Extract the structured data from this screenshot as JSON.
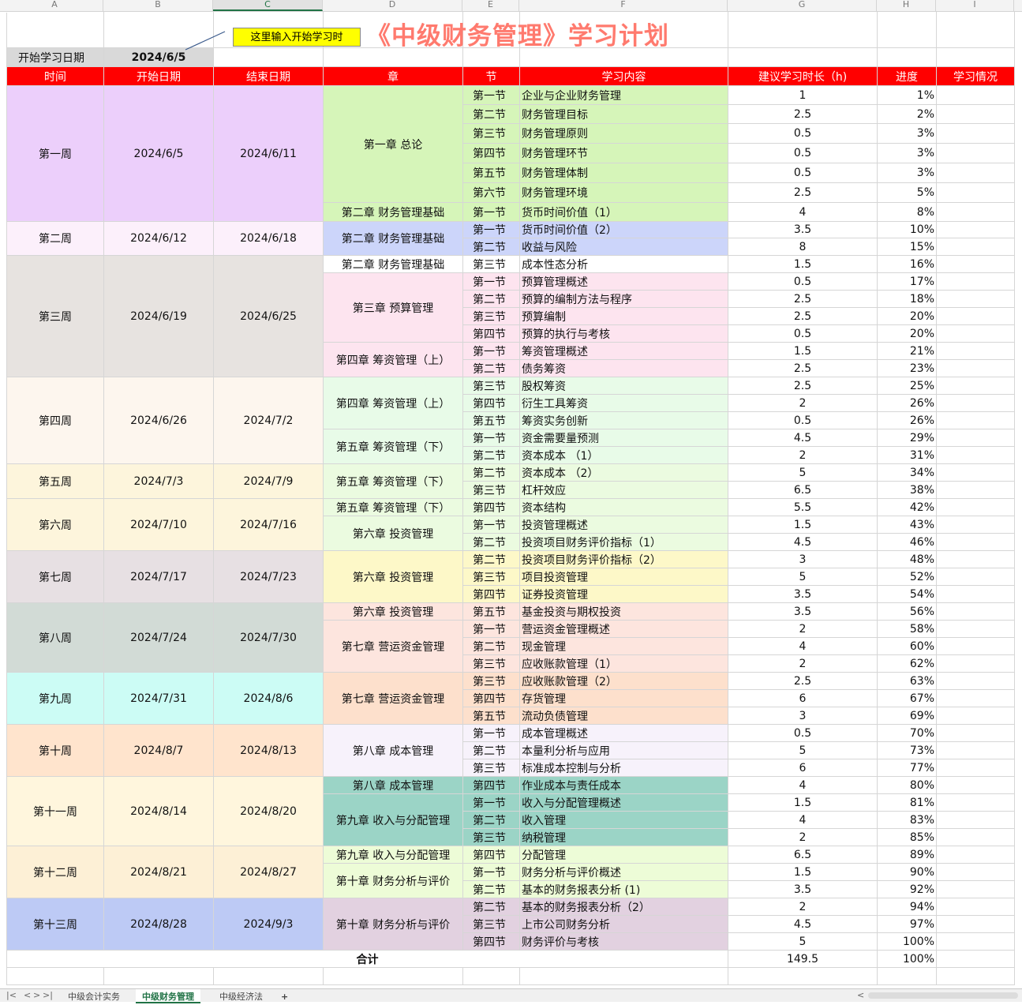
{
  "columns": [
    "A",
    "B",
    "C",
    "D",
    "E",
    "F",
    "G",
    "H",
    "I"
  ],
  "title": "《中级财务管理》学习计划",
  "note": "这里输入开始学习时",
  "start": {
    "label": "开始学习日期",
    "value": "2024/6/5"
  },
  "headers": [
    "时间",
    "开始日期",
    "结束日期",
    "章",
    "节",
    "学习内容",
    "建议学习时长（h)",
    "进度",
    "学习情况"
  ],
  "weeks": [
    {
      "name": "第一周",
      "start": "2024/6/5",
      "end": "2024/6/11",
      "rows": 7,
      "color": "#eccffb"
    },
    {
      "name": "第二周",
      "start": "2024/6/12",
      "end": "2024/6/18",
      "rows": 2,
      "color": "#fcf0fb"
    },
    {
      "name": "第三周",
      "start": "2024/6/19",
      "end": "2024/6/25",
      "rows": 7,
      "color": "#e7e3e0"
    },
    {
      "name": "第四周",
      "start": "2024/6/26",
      "end": "2024/7/2",
      "rows": 5,
      "color": "#fdf6ee"
    },
    {
      "name": "第五周",
      "start": "2024/7/3",
      "end": "2024/7/9",
      "rows": 2,
      "color": "#fdf5dc"
    },
    {
      "name": "第六周",
      "start": "2024/7/10",
      "end": "2024/7/16",
      "rows": 3,
      "color": "#fdf5dc"
    },
    {
      "name": "第七周",
      "start": "2024/7/17",
      "end": "2024/7/23",
      "rows": 3,
      "color": "#e7e0e3"
    },
    {
      "name": "第八周",
      "start": "2024/7/24",
      "end": "2024/7/30",
      "rows": 4,
      "color": "#d2dbd6"
    },
    {
      "name": "第九周",
      "start": "2024/7/31",
      "end": "2024/8/6",
      "rows": 3,
      "color": "#ccfcf5"
    },
    {
      "name": "第十周",
      "start": "2024/8/7",
      "end": "2024/8/13",
      "rows": 3,
      "color": "#ffe4cd"
    },
    {
      "name": "第十一周",
      "start": "2024/8/14",
      "end": "2024/8/20",
      "rows": 4,
      "color": "#fff6dd"
    },
    {
      "name": "第十二周",
      "start": "2024/8/21",
      "end": "2024/8/27",
      "rows": 3,
      "color": "#fdf0d6"
    },
    {
      "name": "第十三周",
      "start": "2024/8/28",
      "end": "2024/9/3",
      "rows": 3,
      "color": "#bdcaf5"
    }
  ],
  "chapters": [
    {
      "name": "第一章 总论",
      "rows": 6,
      "color": "#d6f5b9"
    },
    {
      "name": "第二章 财务管理基础",
      "rows": 1,
      "color": "#d6f5b9"
    },
    {
      "name": "第二章 财务管理基础",
      "rows": 2,
      "color": "#ccd5fa"
    },
    {
      "name": "第二章 财务管理基础",
      "rows": 1,
      "color": "#ffffff"
    },
    {
      "name": "第三章 预算管理",
      "rows": 4,
      "color": "#fde4ef"
    },
    {
      "name": "第四章 筹资管理（上）",
      "rows": 2,
      "color": "#fde4ef"
    },
    {
      "name": "第四章 筹资管理（上）",
      "rows": 3,
      "color": "#e8fbe8"
    },
    {
      "name": "第五章 筹资管理（下）",
      "rows": 2,
      "color": "#e8fbe8"
    },
    {
      "name": "第五章 筹资管理（下）",
      "rows": 2,
      "color": "#ebfbe0"
    },
    {
      "name": "第五章 筹资管理（下）",
      "rows": 1,
      "color": "#ebfbe0"
    },
    {
      "name": "第六章 投资管理",
      "rows": 2,
      "color": "#ebfbe0"
    },
    {
      "name": "第六章 投资管理",
      "rows": 3,
      "color": "#fdf8c8"
    },
    {
      "name": "第六章 投资管理",
      "rows": 1,
      "color": "#fde5de"
    },
    {
      "name": "第七章 营运资金管理",
      "rows": 3,
      "color": "#fde5de"
    },
    {
      "name": "第七章 营运资金管理",
      "rows": 3,
      "color": "#fde0cc"
    },
    {
      "name": "第八章 成本管理",
      "rows": 3,
      "color": "#f7f2fb"
    },
    {
      "name": "第八章 成本管理",
      "rows": 1,
      "color": "#9bd4c6"
    },
    {
      "name": "第九章 收入与分配管理",
      "rows": 3,
      "color": "#9bd4c6"
    },
    {
      "name": "第九章 收入与分配管理",
      "rows": 1,
      "color": "#edfcd7"
    },
    {
      "name": "第十章 财务分析与评价",
      "rows": 2,
      "color": "#edfcd7"
    },
    {
      "name": "第十章 财务分析与评价",
      "rows": 3,
      "color": "#e2d1e0"
    }
  ],
  "rows": [
    {
      "sec": "第一节",
      "content": "企业与企业财务管理",
      "hours": "1",
      "progress": "1%"
    },
    {
      "sec": "第二节",
      "content": "财务管理目标",
      "hours": "2.5",
      "progress": "2%"
    },
    {
      "sec": "第三节",
      "content": "财务管理原则",
      "hours": "0.5",
      "progress": "3%"
    },
    {
      "sec": "第四节",
      "content": "财务管理环节",
      "hours": "0.5",
      "progress": "3%"
    },
    {
      "sec": "第五节",
      "content": "财务管理体制",
      "hours": "0.5",
      "progress": "3%"
    },
    {
      "sec": "第六节",
      "content": "财务管理环境",
      "hours": "2.5",
      "progress": "5%"
    },
    {
      "sec": "第一节",
      "content": "货币时间价值（1）",
      "hours": "4",
      "progress": "8%"
    },
    {
      "sec": "第一节",
      "content": "货币时间价值（2）",
      "hours": "3.5",
      "progress": "10%"
    },
    {
      "sec": "第二节",
      "content": "收益与风险",
      "hours": "8",
      "progress": "15%"
    },
    {
      "sec": "第三节",
      "content": "成本性态分析",
      "hours": "1.5",
      "progress": "16%"
    },
    {
      "sec": "第一节",
      "content": "预算管理概述",
      "hours": "0.5",
      "progress": "17%"
    },
    {
      "sec": "第二节",
      "content": "预算的编制方法与程序",
      "hours": "2.5",
      "progress": "18%"
    },
    {
      "sec": "第三节",
      "content": "预算编制",
      "hours": "2.5",
      "progress": "20%"
    },
    {
      "sec": "第四节",
      "content": "预算的执行与考核",
      "hours": "0.5",
      "progress": "20%"
    },
    {
      "sec": "第一节",
      "content": "筹资管理概述",
      "hours": "1.5",
      "progress": "21%"
    },
    {
      "sec": "第二节",
      "content": "债务筹资",
      "hours": "2.5",
      "progress": "23%"
    },
    {
      "sec": "第三节",
      "content": "股权筹资",
      "hours": "2.5",
      "progress": "25%"
    },
    {
      "sec": "第四节",
      "content": "衍生工具筹资",
      "hours": "2",
      "progress": "26%"
    },
    {
      "sec": "第五节",
      "content": "筹资实务创新",
      "hours": "0.5",
      "progress": "26%"
    },
    {
      "sec": "第一节",
      "content": "资金需要量预测",
      "hours": "4.5",
      "progress": "29%"
    },
    {
      "sec": "第二节",
      "content": "资本成本 （1）",
      "hours": "2",
      "progress": "31%"
    },
    {
      "sec": "第二节",
      "content": "资本成本 （2）",
      "hours": "5",
      "progress": "34%"
    },
    {
      "sec": "第三节",
      "content": "杠杆效应",
      "hours": "6.5",
      "progress": "38%"
    },
    {
      "sec": "第四节",
      "content": "资本结构",
      "hours": "5.5",
      "progress": "42%"
    },
    {
      "sec": "第一节",
      "content": "投资管理概述",
      "hours": "1.5",
      "progress": "43%"
    },
    {
      "sec": "第二节",
      "content": "投资项目财务评价指标（1）",
      "hours": "4.5",
      "progress": "46%"
    },
    {
      "sec": "第二节",
      "content": "投资项目财务评价指标（2）",
      "hours": "3",
      "progress": "48%"
    },
    {
      "sec": "第三节",
      "content": "项目投资管理",
      "hours": "5",
      "progress": "52%"
    },
    {
      "sec": "第四节",
      "content": "证券投资管理",
      "hours": "3.5",
      "progress": "54%"
    },
    {
      "sec": "第五节",
      "content": "基金投资与期权投资",
      "hours": "3.5",
      "progress": "56%"
    },
    {
      "sec": "第一节",
      "content": "营运资金管理概述",
      "hours": "2",
      "progress": "58%"
    },
    {
      "sec": "第二节",
      "content": "现金管理",
      "hours": "4",
      "progress": "60%"
    },
    {
      "sec": "第三节",
      "content": "应收账款管理（1）",
      "hours": "2",
      "progress": "62%"
    },
    {
      "sec": "第三节",
      "content": "应收账款管理（2）",
      "hours": "2.5",
      "progress": "63%"
    },
    {
      "sec": "第四节",
      "content": "存货管理",
      "hours": "6",
      "progress": "67%"
    },
    {
      "sec": "第五节",
      "content": "流动负债管理",
      "hours": "3",
      "progress": "69%"
    },
    {
      "sec": "第一节",
      "content": "成本管理概述",
      "hours": "0.5",
      "progress": "70%"
    },
    {
      "sec": "第二节",
      "content": "本量利分析与应用",
      "hours": "5",
      "progress": "73%"
    },
    {
      "sec": "第三节",
      "content": "标准成本控制与分析",
      "hours": "6",
      "progress": "77%"
    },
    {
      "sec": "第四节",
      "content": "作业成本与责任成本",
      "hours": "4",
      "progress": "80%"
    },
    {
      "sec": "第一节",
      "content": "收入与分配管理概述",
      "hours": "1.5",
      "progress": "81%"
    },
    {
      "sec": "第二节",
      "content": "收入管理",
      "hours": "4",
      "progress": "83%"
    },
    {
      "sec": "第三节",
      "content": "纳税管理",
      "hours": "2",
      "progress": "85%"
    },
    {
      "sec": "第四节",
      "content": "分配管理",
      "hours": "6.5",
      "progress": "89%"
    },
    {
      "sec": "第一节",
      "content": "财务分析与评价概述",
      "hours": "1.5",
      "progress": "90%"
    },
    {
      "sec": "第二节",
      "content": "基本的财务报表分析 (1)",
      "hours": "3.5",
      "progress": "92%"
    },
    {
      "sec": "第二节",
      "content": "基本的财务报表分析（2）",
      "hours": "2",
      "progress": "94%"
    },
    {
      "sec": "第三节",
      "content": "上市公司财务分析",
      "hours": "4.5",
      "progress": "97%"
    },
    {
      "sec": "第四节",
      "content": "财务评价与考核",
      "hours": "5",
      "progress": "100%"
    }
  ],
  "total": {
    "label": "合计",
    "hours": "149.5",
    "progress": "100%"
  },
  "sheet_tabs": [
    "中级会计实务",
    "中级财务管理",
    "中级经济法"
  ],
  "active_tab": "中级财务管理",
  "add_tab": "+"
}
